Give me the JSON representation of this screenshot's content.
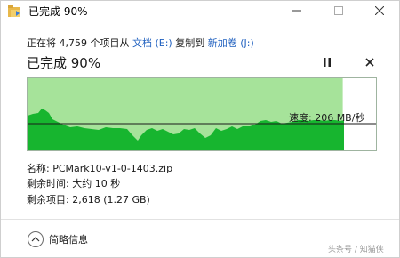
{
  "window": {
    "title": "已完成 90%",
    "minimize_label": "",
    "maximize_label": "",
    "close_label": ""
  },
  "copy": {
    "prefix": "正在将 4,759 个项目从 ",
    "source": "文档 (E:)",
    "middle": " 复制到 ",
    "destination": "新加卷 (J:)"
  },
  "progress": {
    "heading": "已完成 90%",
    "percent": 90,
    "speed_label": "速度: 206 MB/秒"
  },
  "details": {
    "name_line": "名称: PCMark10-v1-0-1403.zip",
    "time_line": "剩余时间: 大约 10 秒",
    "items_line": "剩余项目: 2,618 (1.27 GB)"
  },
  "footer": {
    "less_details_label": "简略信息"
  },
  "watermark": "头条号 / 知猫侠",
  "colors": {
    "progress_fill": "#a6e39a",
    "speed_fill": "#17b52f",
    "link": "#1e5fbf",
    "folder_icon": "#e8b84a"
  },
  "icons": {
    "title": "folder-copy-icon",
    "pause": "pause-icon",
    "stop": "close-icon",
    "expand": "chevron-up-icon"
  }
}
